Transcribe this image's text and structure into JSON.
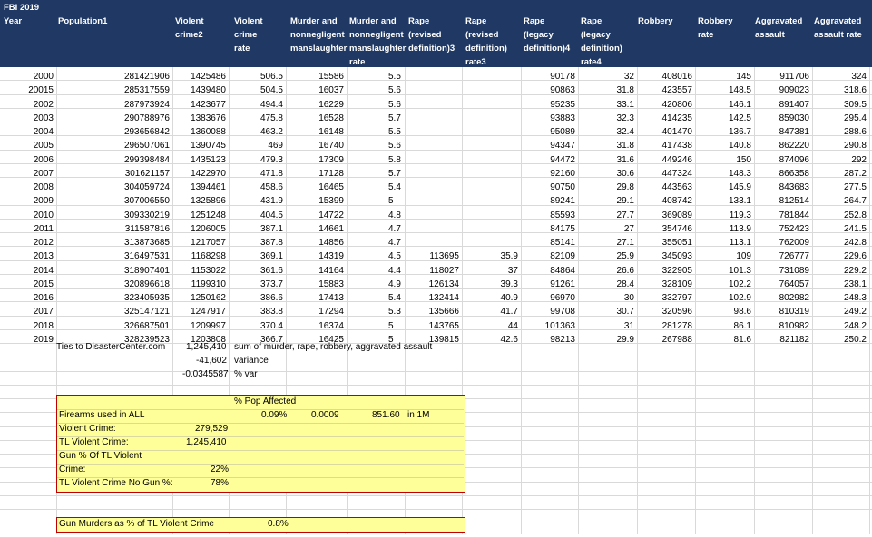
{
  "sheet": {
    "title": "FBI 2019",
    "headers": [
      "Year",
      "Population1",
      "Violent\ncrime2",
      "Violent\ncrime\nrate",
      "Murder and\nnonnegligent\nmanslaughter",
      "Murder and\nnonnegligent\nmanslaughter\nrate",
      "Rape\n(revised\ndefinition)3",
      "Rape\n(revised\ndefinition)\nrate3",
      "Rape\n(legacy\ndefinition)4",
      "Rape\n(legacy\ndefinition)\nrate4",
      "Robbery",
      "Robbery\nrate",
      "Aggravated\nassault",
      "Aggravated\nassault rate"
    ],
    "rows": [
      [
        "2000",
        "281421906",
        "1425486",
        "506.5",
        "15586",
        "5.5",
        "",
        "",
        "90178",
        "32",
        "408016",
        "145",
        "911706",
        "324"
      ],
      [
        "20015",
        "285317559",
        "1439480",
        "504.5",
        "16037",
        "5.6",
        "",
        "",
        "90863",
        "31.8",
        "423557",
        "148.5",
        "909023",
        "318.6"
      ],
      [
        "2002",
        "287973924",
        "1423677",
        "494.4",
        "16229",
        "5.6",
        "",
        "",
        "95235",
        "33.1",
        "420806",
        "146.1",
        "891407",
        "309.5"
      ],
      [
        "2003",
        "290788976",
        "1383676",
        "475.8",
        "16528",
        "5.7",
        "",
        "",
        "93883",
        "32.3",
        "414235",
        "142.5",
        "859030",
        "295.4"
      ],
      [
        "2004",
        "293656842",
        "1360088",
        "463.2",
        "16148",
        "5.5",
        "",
        "",
        "95089",
        "32.4",
        "401470",
        "136.7",
        "847381",
        "288.6"
      ],
      [
        "2005",
        "296507061",
        "1390745",
        "469",
        "16740",
        "5.6",
        "",
        "",
        "94347",
        "31.8",
        "417438",
        "140.8",
        "862220",
        "290.8"
      ],
      [
        "2006",
        "299398484",
        "1435123",
        "479.3",
        "17309",
        "5.8",
        "",
        "",
        "94472",
        "31.6",
        "449246",
        "150",
        "874096",
        "292"
      ],
      [
        "2007",
        "301621157",
        "1422970",
        "471.8",
        "17128",
        "5.7",
        "",
        "",
        "92160",
        "30.6",
        "447324",
        "148.3",
        "866358",
        "287.2"
      ],
      [
        "2008",
        "304059724",
        "1394461",
        "458.6",
        "16465",
        "5.4",
        "",
        "",
        "90750",
        "29.8",
        "443563",
        "145.9",
        "843683",
        "277.5"
      ],
      [
        "2009",
        "307006550",
        "1325896",
        "431.9",
        "15399",
        "5",
        "",
        "",
        "89241",
        "29.1",
        "408742",
        "133.1",
        "812514",
        "264.7"
      ],
      [
        "2010",
        "309330219",
        "1251248",
        "404.5",
        "14722",
        "4.8",
        "",
        "",
        "85593",
        "27.7",
        "369089",
        "119.3",
        "781844",
        "252.8"
      ],
      [
        "2011",
        "311587816",
        "1206005",
        "387.1",
        "14661",
        "4.7",
        "",
        "",
        "84175",
        "27",
        "354746",
        "113.9",
        "752423",
        "241.5"
      ],
      [
        "2012",
        "313873685",
        "1217057",
        "387.8",
        "14856",
        "4.7",
        "",
        "",
        "85141",
        "27.1",
        "355051",
        "113.1",
        "762009",
        "242.8"
      ],
      [
        "2013",
        "316497531",
        "1168298",
        "369.1",
        "14319",
        "4.5",
        "113695",
        "35.9",
        "82109",
        "25.9",
        "345093",
        "109",
        "726777",
        "229.6"
      ],
      [
        "2014",
        "318907401",
        "1153022",
        "361.6",
        "14164",
        "4.4",
        "118027",
        "37",
        "84864",
        "26.6",
        "322905",
        "101.3",
        "731089",
        "229.2"
      ],
      [
        "2015",
        "320896618",
        "1199310",
        "373.7",
        "15883",
        "4.9",
        "126134",
        "39.3",
        "91261",
        "28.4",
        "328109",
        "102.2",
        "764057",
        "238.1"
      ],
      [
        "2016",
        "323405935",
        "1250162",
        "386.6",
        "17413",
        "5.4",
        "132414",
        "40.9",
        "96970",
        "30",
        "332797",
        "102.9",
        "802982",
        "248.3"
      ],
      [
        "2017",
        "325147121",
        "1247917",
        "383.8",
        "17294",
        "5.3",
        "135666",
        "41.7",
        "99708",
        "30.7",
        "320596",
        "98.6",
        "810319",
        "249.2"
      ],
      [
        "2018",
        "326687501",
        "1209997",
        "370.4",
        "16374",
        "5",
        "143765",
        "44",
        "101363",
        "31",
        "281278",
        "86.1",
        "810982",
        "248.2"
      ],
      [
        "2019",
        "328239523",
        "1203808",
        "366.7",
        "16425",
        "5",
        "139815",
        "42.6",
        "98213",
        "29.9",
        "267988",
        "81.6",
        "821182",
        "250.2"
      ]
    ],
    "summary": {
      "source": "Ties to DisasterCenter.com",
      "total": "1,245,410",
      "total_note": "sum of murder, rape, robbery, aggravated assault",
      "variance": "-41,602",
      "variance_label": "variance",
      "pct_var": "-0.0345587",
      "pct_var_label": "% var"
    },
    "firearms_box": {
      "pop_affected_label": "% Pop Affected",
      "firearms_label": "Firearms used in ALL",
      "pct": "0.09%",
      "ratio": "0.0009",
      "per_million": "851.60",
      "per_million_unit": "in 1M",
      "violent_label": "Violent Crime:",
      "violent_value": "279,529",
      "tl_label": "TL Violent Crime:",
      "tl_value": "1,245,410",
      "gun_pct_label_1": "Gun % Of TL Violent",
      "gun_pct_label_2": "Crime:",
      "gun_pct_value": "22%",
      "no_gun_label": "TL Violent Crime No Gun %:",
      "no_gun_value": "78%"
    },
    "gun_murders": {
      "label": "Gun Murders as % of TL Violent Crime",
      "value": "0.8%"
    }
  }
}
